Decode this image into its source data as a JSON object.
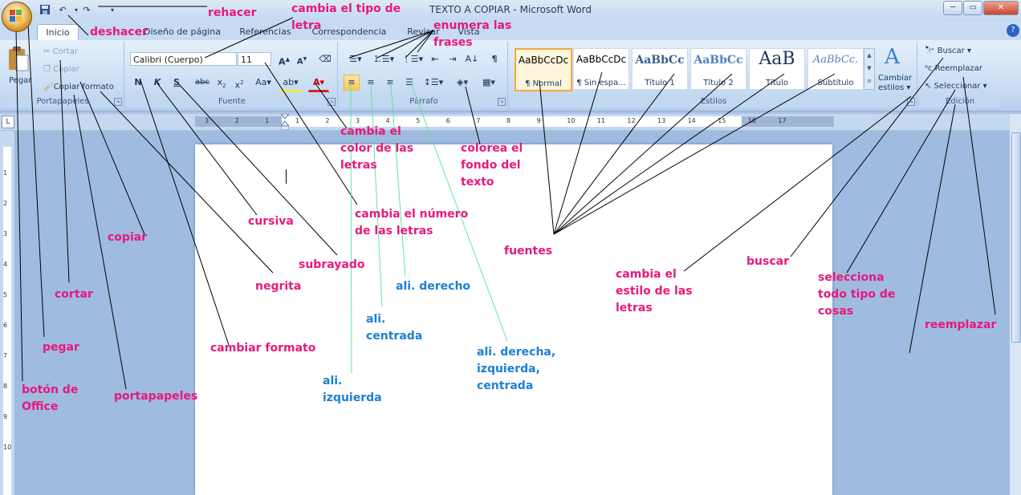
{
  "window": {
    "title": "TEXTO A COPIAR - Microsoft Word",
    "controls": [
      "minimize",
      "maximize",
      "close"
    ]
  },
  "quick_access": {
    "icons": [
      "save-icon",
      "undo-icon",
      "redo-icon",
      "customize-icon"
    ]
  },
  "tabs": [
    {
      "label": "Inicio",
      "active": true
    },
    {
      "label": "Diseño de página"
    },
    {
      "label": "Referencias"
    },
    {
      "label": "Correspondencia"
    },
    {
      "label": "Revisar"
    },
    {
      "label": "Vista"
    }
  ],
  "ribbon": {
    "clipboard": {
      "label": "Portapapeles",
      "paste": "Pegar",
      "cut": "Cortar",
      "copy": "Copiar",
      "format_painter": "Copiar formato"
    },
    "font": {
      "label": "Fuente",
      "font_name": "Calibri (Cuerpo)",
      "font_size": "11"
    },
    "paragraph": {
      "label": "Párrafo"
    },
    "styles": {
      "label": "Estilos",
      "tiles": [
        {
          "sample": "AaBbCcDc",
          "name": "¶ Normal"
        },
        {
          "sample": "AaBbCcDc",
          "name": "¶ Sin espa..."
        },
        {
          "sample": "AaBbCc",
          "name": "Título 1"
        },
        {
          "sample": "AaBbCc",
          "name": "Título 2"
        },
        {
          "sample": "AaB",
          "name": "Título"
        },
        {
          "sample": "AaBbCc.",
          "name": "Subtítulo"
        }
      ],
      "change_styles": [
        "Cambiar",
        "estilos ▾"
      ]
    },
    "editing": {
      "label": "Edición",
      "find": "Buscar ▾",
      "replace": "Reemplazar",
      "select": "Seleccionar ▾"
    }
  },
  "ruler": {
    "numbers": [
      "3",
      "2",
      "1",
      "1",
      "2",
      "3",
      "4",
      "5",
      "6",
      "7",
      "8",
      "9",
      "10",
      "11",
      "12",
      "13",
      "14",
      "15",
      "16",
      "17"
    ]
  },
  "vruler": {
    "numbers": [
      "1",
      "2",
      "3",
      "4",
      "5",
      "6",
      "7",
      "8",
      "9",
      "10"
    ]
  },
  "annotations": {
    "rehacer": "rehacer",
    "deshacer": "deshacer",
    "cambia_tipo": "cambia el tipo de\nletra",
    "enumera": "enumera las\nfrases",
    "cambia_color": "cambia el\ncolor de las\nletras",
    "colorea_fondo": "colorea el\nfondo del\ntexto",
    "cambia_numero": "cambia el número\nde las letras",
    "cursiva": "cursiva",
    "copiar": "copiar",
    "subrayado": "subrayado",
    "fuentes": "fuentes",
    "negrita": "negrita",
    "cortar": "cortar",
    "ali_derecho": "ali. derecho",
    "cambia_estilo": "cambia el\nestilo de las\nletras",
    "buscar": "buscar",
    "selecciona": "selecciona\ntodo tipo de\ncosas",
    "ali_centrada": "ali.\ncentrada",
    "reemplazar": "reemplazar",
    "pegar": "pegar",
    "cambiar_formato": "cambiar formato",
    "ali_der_izq_cen": "ali. derecha,\nizquierda,\ncentrada",
    "ali_izquierda": "ali.\nizquierda",
    "boton_office": "botón de\nOffice",
    "portapapeles": "portapapeles"
  },
  "colors": {
    "annotation_pink": "#e8187d",
    "annotation_blue": "#1a7fd6",
    "leader_line": "#000000",
    "leader_line_green": "#5fe6a0",
    "ribbon_bg": "#d5e4f6"
  }
}
